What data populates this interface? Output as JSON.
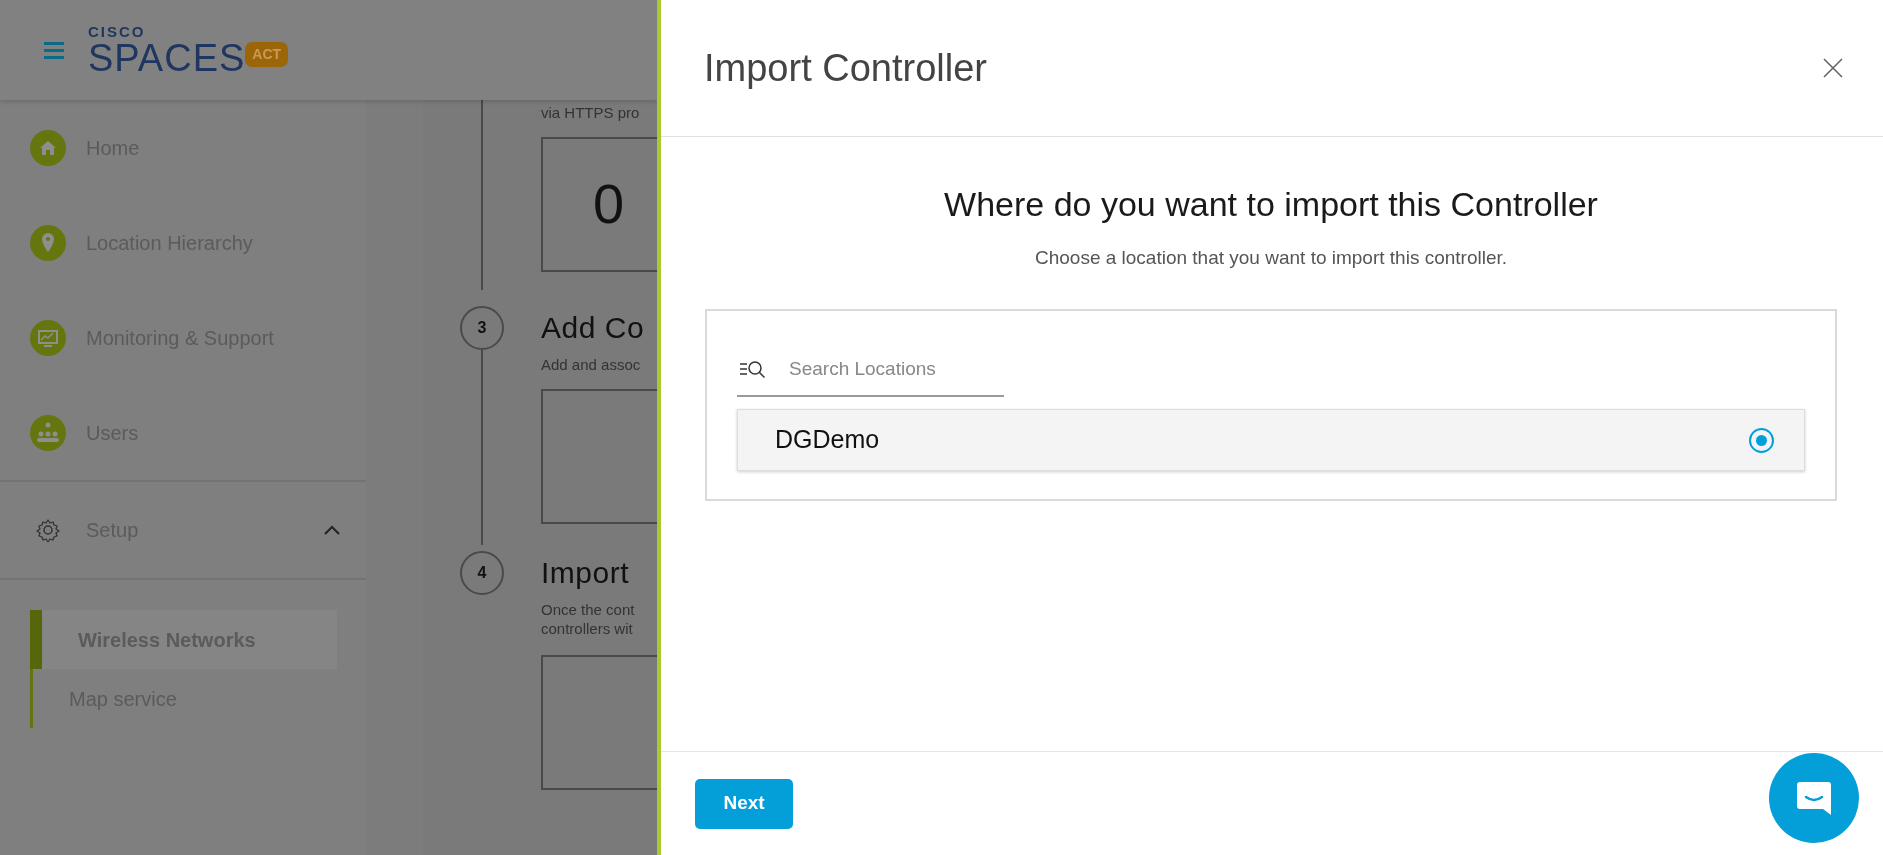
{
  "app_header": {
    "logo": {
      "brand": "CISCO",
      "product": "SPACES",
      "badge": "ACT"
    }
  },
  "sidebar": {
    "items": [
      {
        "label": "Home"
      },
      {
        "label": "Location Hierarchy"
      },
      {
        "label": "Monitoring & Support"
      },
      {
        "label": "Users"
      }
    ],
    "setup": {
      "label": "Setup",
      "expanded": true,
      "children": [
        {
          "label": "Wireless Networks",
          "selected": true
        },
        {
          "label": "Map service",
          "selected": false
        }
      ]
    }
  },
  "steps": [
    {
      "description": "via HTTPS pro",
      "count": "0"
    },
    {
      "number": "3",
      "title": "Add Co",
      "description": "Add and assoc"
    },
    {
      "number": "4",
      "title": "Import",
      "description": "Once the cont",
      "description_2": "controllers wit"
    }
  ],
  "modal": {
    "title": "Import Controller",
    "heading": "Where do you want to import this Controller",
    "subtitle": "Choose a location that you want to import this controller.",
    "search": {
      "placeholder": "Search Locations"
    },
    "locations": [
      {
        "name": "DGDemo",
        "selected": true
      }
    ],
    "next_button": "Next"
  }
}
